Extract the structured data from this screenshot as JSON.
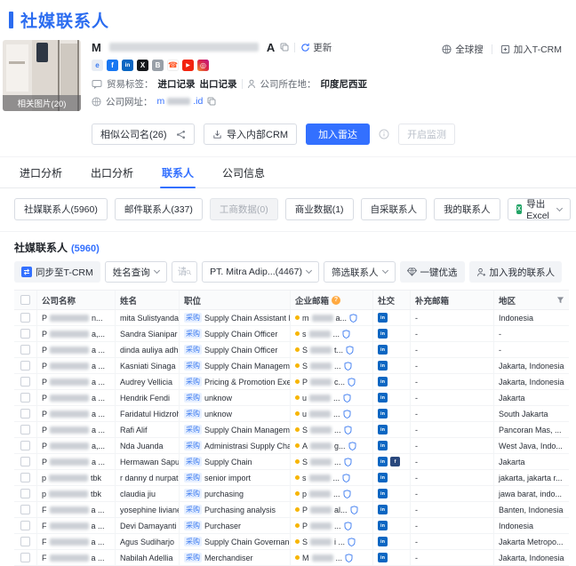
{
  "page_title": "社媒联系人",
  "company": {
    "name_prefix": "M",
    "name_suffix": "A",
    "refresh": "更新",
    "photo_badge": "相关图片(20)",
    "social_icons": [
      {
        "type": "browser",
        "glyph": "e"
      },
      {
        "type": "facebook",
        "glyph": "f"
      },
      {
        "type": "linkedin",
        "glyph": "in"
      },
      {
        "type": "x",
        "glyph": "X"
      },
      {
        "type": "book",
        "glyph": "B"
      },
      {
        "type": "phone",
        "glyph": "☎"
      },
      {
        "type": "youtube",
        "glyph": "▶"
      },
      {
        "type": "instagram",
        "glyph": "◎"
      }
    ],
    "trade_label": "贸易标签：",
    "trade_tag_import": "进口记录",
    "trade_tag_export": "出口记录",
    "location_label": "公司所在地：",
    "location": "印度尼西亚",
    "website_label": "公司网址：",
    "website_prefix": "m",
    "website_suffix": ".id"
  },
  "header_links": {
    "global_search": "全球搜",
    "join_tcrm": "加入T-CRM"
  },
  "actions": {
    "similar_companies": "相似公司名(26)",
    "import_crm": "导入内部CRM",
    "join_radar": "加入雷达",
    "start_monitor": "开启监测"
  },
  "tabs": [
    {
      "label": "进口分析",
      "active": false
    },
    {
      "label": "出口分析",
      "active": false
    },
    {
      "label": "联系人",
      "active": true
    },
    {
      "label": "公司信息",
      "active": false
    }
  ],
  "subtabs": [
    {
      "label": "社媒联系人(5960)",
      "disabled": false
    },
    {
      "label": "邮件联系人(337)",
      "disabled": false
    },
    {
      "label": "工商数据(0)",
      "disabled": true
    },
    {
      "label": "商业数据(1)",
      "disabled": false
    },
    {
      "label": "自采联系人",
      "disabled": false
    },
    {
      "label": "我的联系人",
      "disabled": false
    }
  ],
  "export_excel": "导出 Excel",
  "list_section": {
    "title": "社媒联系人",
    "count": "(5960)",
    "sync_btn": "同步至T-CRM",
    "name_query": "姓名查询",
    "name_placeholder": "请输入姓名",
    "company_select": "PT. Mitra Adip...(4467)",
    "filter_contacts": "筛选联系人",
    "quick_pick": "一键优选",
    "add_to_contacts": "加入我的联系人"
  },
  "table": {
    "headers": {
      "company": "公司名称",
      "name": "姓名",
      "position": "职位",
      "email": "企业邮箱",
      "social": "社交",
      "extra_email": "补充邮箱",
      "region": "地区"
    },
    "position_tag": "采购",
    "rows": [
      {
        "company_prefix": "P",
        "company_suffix": "n...",
        "name": "mita Sulistyandari",
        "position": "Supply Chain Assistant Man...",
        "email_prefix": "m",
        "email_suffix": "a...",
        "socials": [
          "linkedin"
        ],
        "extra_email": "-",
        "region": "Indonesia"
      },
      {
        "company_prefix": "P",
        "company_suffix": "a,...",
        "name": "Sandra Sianipar",
        "position": "Supply Chain Officer",
        "email_prefix": "s",
        "email_suffix": "...",
        "socials": [
          "linkedin"
        ],
        "extra_email": "-",
        "region": "-"
      },
      {
        "company_prefix": "P",
        "company_suffix": "a ...",
        "name": "dinda auliya adha",
        "position": "Supply Chain Officer",
        "email_prefix": "S",
        "email_suffix": "t...",
        "socials": [
          "linkedin"
        ],
        "extra_email": "-",
        "region": "-"
      },
      {
        "company_prefix": "P",
        "company_suffix": "a ...",
        "name": "Kasniati Sinaga",
        "position": "Supply Chain Management",
        "email_prefix": "S",
        "email_suffix": "...",
        "socials": [
          "linkedin"
        ],
        "extra_email": "-",
        "region": "Jakarta, Indonesia"
      },
      {
        "company_prefix": "P",
        "company_suffix": "a ...",
        "name": "Audrey Vellicia",
        "position": "Pricing & Promotion Execut...",
        "email_prefix": "P",
        "email_suffix": "c...",
        "socials": [
          "linkedin"
        ],
        "extra_email": "-",
        "region": "Jakarta, Indonesia"
      },
      {
        "company_prefix": "P",
        "company_suffix": "a ...",
        "name": "Hendrik Fendi",
        "position": "unknow",
        "email_prefix": "u",
        "email_suffix": "...",
        "socials": [
          "linkedin"
        ],
        "extra_email": "-",
        "region": "Jakarta"
      },
      {
        "company_prefix": "P",
        "company_suffix": "a ...",
        "name": "Faridatul Hidzroh",
        "position": "unknow",
        "email_prefix": "u",
        "email_suffix": "...",
        "socials": [
          "linkedin"
        ],
        "extra_email": "-",
        "region": "South Jakarta"
      },
      {
        "company_prefix": "P",
        "company_suffix": "a ...",
        "name": "Rafi Alif",
        "position": "Supply Chain Management ...",
        "email_prefix": "S",
        "email_suffix": "...",
        "socials": [
          "linkedin"
        ],
        "extra_email": "-",
        "region": "Pancoran Mas, ..."
      },
      {
        "company_prefix": "P",
        "company_suffix": "a,...",
        "name": "Nda Juanda",
        "position": "Administrasi Supply Chain (...",
        "email_prefix": "A",
        "email_suffix": "g...",
        "socials": [
          "linkedin"
        ],
        "extra_email": "-",
        "region": "West Java, Indo..."
      },
      {
        "company_prefix": "P",
        "company_suffix": "a ...",
        "name": "Hermawan Sapu...",
        "position": "Supply Chain",
        "email_prefix": "S",
        "email_suffix": "...",
        "socials": [
          "linkedin",
          "facebook"
        ],
        "extra_email": "-",
        "region": "Jakarta"
      },
      {
        "company_prefix": "p",
        "company_suffix": "tbk",
        "name": "r danny d nurpat...",
        "position": "senior import",
        "email_prefix": "s",
        "email_suffix": "...",
        "socials": [
          "linkedin"
        ],
        "extra_email": "-",
        "region": "jakarta, jakarta r..."
      },
      {
        "company_prefix": "p",
        "company_suffix": "tbk",
        "name": "claudia jiu",
        "position": "purchasing",
        "email_prefix": "p",
        "email_suffix": "...",
        "socials": [
          "linkedin"
        ],
        "extra_email": "-",
        "region": "jawa barat, indo..."
      },
      {
        "company_prefix": "F",
        "company_suffix": "a ...",
        "name": "yosephine liviane",
        "position": "Purchasing analysis",
        "email_prefix": "P",
        "email_suffix": "al...",
        "socials": [
          "linkedin"
        ],
        "extra_email": "-",
        "region": "Banten, Indonesia"
      },
      {
        "company_prefix": "F",
        "company_suffix": "a ...",
        "name": "Devi Damayanti",
        "position": "Purchaser",
        "email_prefix": "P",
        "email_suffix": "...",
        "socials": [
          "linkedin"
        ],
        "extra_email": "-",
        "region": "Indonesia"
      },
      {
        "company_prefix": "F",
        "company_suffix": "a ...",
        "name": "Agus Sudiharjo",
        "position": "Supply Chain Governance In...",
        "email_prefix": "S",
        "email_suffix": "i ...",
        "socials": [
          "linkedin"
        ],
        "extra_email": "-",
        "region": "Jakarta Metropo..."
      },
      {
        "company_prefix": "F",
        "company_suffix": "a ...",
        "name": "Nabilah Adellia",
        "position": "Merchandiser",
        "email_prefix": "M",
        "email_suffix": "...",
        "socials": [
          "linkedin"
        ],
        "extra_email": "-",
        "region": "Jakarta, Indonesia"
      }
    ]
  }
}
